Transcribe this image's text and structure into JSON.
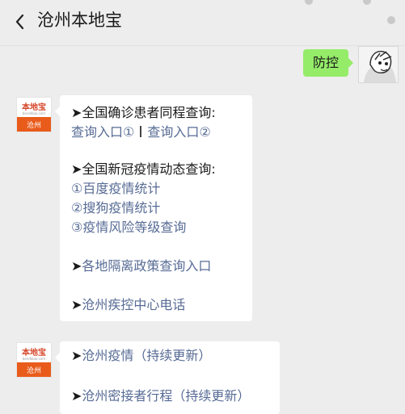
{
  "header": {
    "title": "沧州本地宝",
    "back_icon": "back-arrow-icon"
  },
  "outgoing": {
    "text": "防控"
  },
  "messages": [
    {
      "sender": "沧州本地宝",
      "avatar": {
        "brand": "本地宝",
        "site": "bendibao.com",
        "city": "沧州"
      },
      "sections": {
        "s1_title": "全国确诊患者同程查询:",
        "s1_link1": "查询入口①",
        "s1_link2": "查询入口②",
        "s2_title": "全国新冠疫情动态查询:",
        "s2_link1": "①百度疫情统计",
        "s2_link2": "②搜狗疫情统计",
        "s2_link3": "③疫情风险等级查询",
        "s3_link": "各地隔离政策查询入口",
        "s4_link": "沧州疾控中心电话"
      }
    },
    {
      "sender": "沧州本地宝",
      "avatar": {
        "brand": "本地宝",
        "site": "bendibao.com",
        "city": "沧州"
      },
      "items": [
        "沧州疫情（持续更新）",
        "沧州密接者行程（持续更新）"
      ]
    }
  ],
  "arrow_glyph": "➤",
  "colors": {
    "link": "#576b95",
    "outgoing_bubble": "#95ec69",
    "avatar_orange": "#e95b1b"
  }
}
